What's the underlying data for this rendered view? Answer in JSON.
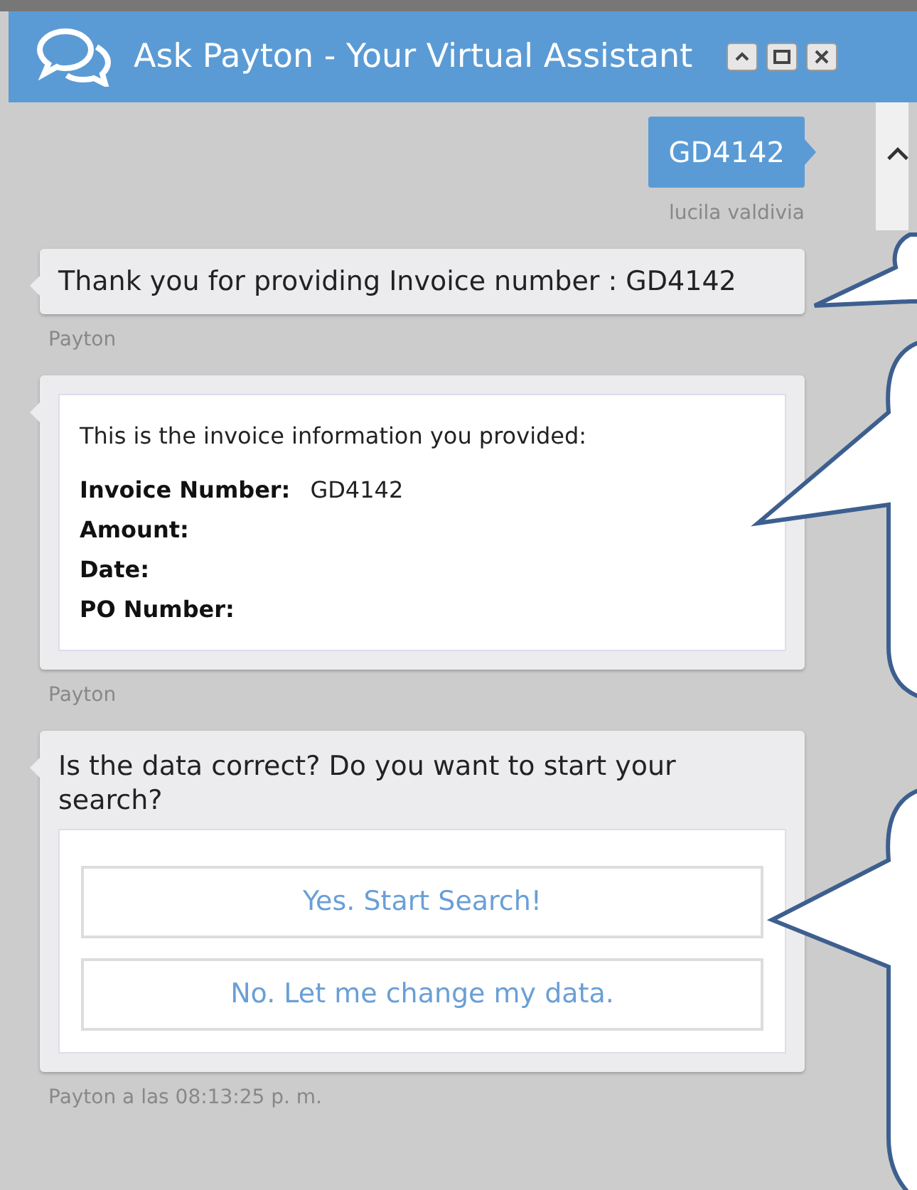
{
  "window": {
    "title": "Ask Payton - Your Virtual Assistant"
  },
  "messages": [
    {
      "kind": "user",
      "text": "GD4142",
      "author": "lucila valdivia"
    },
    {
      "kind": "text",
      "text": "Thank you for providing Invoice number : GD4142",
      "author": "Payton"
    },
    {
      "kind": "info",
      "intro": "This is the invoice information you provided:",
      "fields": [
        {
          "label": "Invoice Number:",
          "value": "GD4142"
        },
        {
          "label": "Amount:"
        },
        {
          "label": "Date:"
        },
        {
          "label": "PO Number:"
        }
      ],
      "author": "Payton"
    },
    {
      "kind": "choices",
      "text": "Is the data correct? Do you want to start your search?",
      "options": [
        "Yes. Start Search!",
        "No. Let me change my data."
      ],
      "author": "Payton a las 08:13:25 p. m."
    }
  ]
}
